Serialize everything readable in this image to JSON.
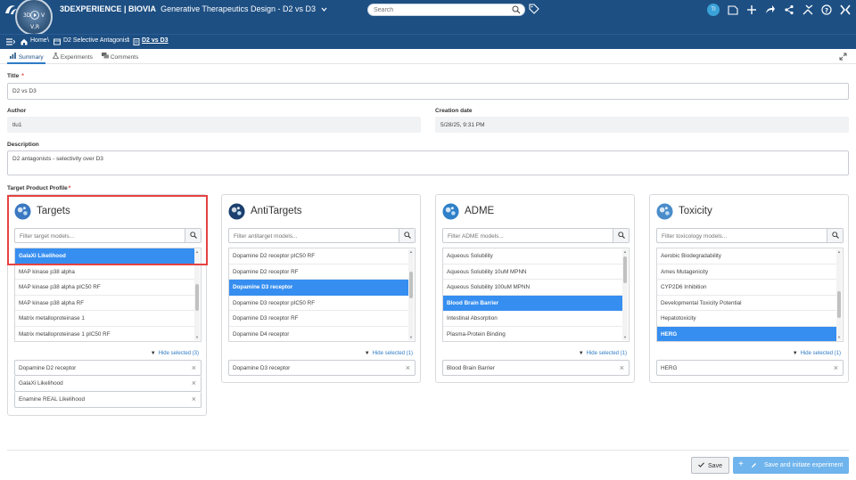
{
  "topbar": {
    "compass_labels": {
      "left": "3D",
      "right": "V",
      "bottom": "V,R"
    },
    "brand": "3DEXPERIENCE | BIOVIA",
    "app_name": "Generative Therapeutics Design - D2 vs D3",
    "search_placeholder": "Search",
    "avatar_initials": "TI",
    "icons": [
      "tag-icon",
      "comment-icon",
      "add-icon",
      "share-icon",
      "network-icon",
      "tools-icon",
      "help-icon",
      "compass-apps-icon"
    ]
  },
  "breadcrumb": {
    "home": "Home",
    "project": "D2 Selective Antagonist",
    "current": "D2 vs D3"
  },
  "tabs": [
    {
      "label": "Summary",
      "active": true
    },
    {
      "label": "Experiments",
      "active": false
    },
    {
      "label": "Comments",
      "active": false
    }
  ],
  "form": {
    "title_label": "Title",
    "title_value": "D2 vs D3",
    "author_label": "Author",
    "author_value": "tlu1",
    "creation_label": "Creation date",
    "creation_value": "5/28/25, 9:31 PM",
    "description_label": "Description",
    "description_value": "D2 antagonists - selectivity over D3",
    "tpp_label": "Target Product Profile",
    "required_mark": "*"
  },
  "cards": [
    {
      "title": "Targets",
      "placeholder": "Filter target models...",
      "items": [
        "GalaXi Likelihood",
        "MAP kinase p38 alpha",
        "MAP kinase p38 alpha pIC50 RF",
        "MAP kinase p38 alpha RF",
        "Matrix metalloproteinase 1",
        "Matrix metalloproteinase 1 pIC50 RF"
      ],
      "selected_index": 0,
      "scroll_thumb": 0.55,
      "hide_selected": "Hide selected (3)",
      "chips": [
        "Dopamine D2 receptor",
        "GalaXi Likelihood",
        "Enamine REAL Likelihood"
      ],
      "icon_color": "#3a78c2"
    },
    {
      "title": "AntiTargets",
      "placeholder": "Filter antitarget models...",
      "items": [
        "Dopamine D2 receptor pIC50 RF",
        "Dopamine D2 receptor RF",
        "Dopamine D3 receptor",
        "Dopamine D3 receptor pIC50 RF",
        "Dopamine D3 receptor RF",
        "Dopamine D4 receptor"
      ],
      "selected_index": 2,
      "scroll_thumb": 0.3,
      "hide_selected": "Hide selected (1)",
      "chips": [
        "Dopamine D3 receptor"
      ],
      "icon_color": "#1b3f6e"
    },
    {
      "title": "ADME",
      "placeholder": "Filter ADME models...",
      "items": [
        "Aqueous Solubility",
        "Aqueous Solubility 10uM MPNN",
        "Aqueous Solubility 100uM MPNN",
        "Blood Brain Barrier",
        "Intestinal Absorption",
        "Plasma-Protein Binding"
      ],
      "selected_index": 3,
      "scroll_thumb": 0.0,
      "hide_selected": "Hide selected (1)",
      "chips": [
        "Blood Brain Barrier"
      ],
      "icon_color": "#2f80c9"
    },
    {
      "title": "Toxicity",
      "placeholder": "Filter toxicology models...",
      "items": [
        "Aerobic Biodegradability",
        "Ames Mutagenicity",
        "CYP2D6 Inhibition",
        "Developmental Toxicity Potential",
        "Hepatotoxicity",
        "HERG"
      ],
      "selected_index": 5,
      "scroll_thumb": 0.7,
      "hide_selected": "Hide selected (1)",
      "chips": [
        "HERG"
      ],
      "icon_color": "#4a8cc9"
    }
  ],
  "footer": {
    "save_label": "Save",
    "save_init_label": "Save and initiate experiment"
  },
  "colors": {
    "topbar": "#1d4f83",
    "selection": "#368ef0",
    "highlight_box": "#e54242",
    "primary_button": "#6fb4ec"
  }
}
